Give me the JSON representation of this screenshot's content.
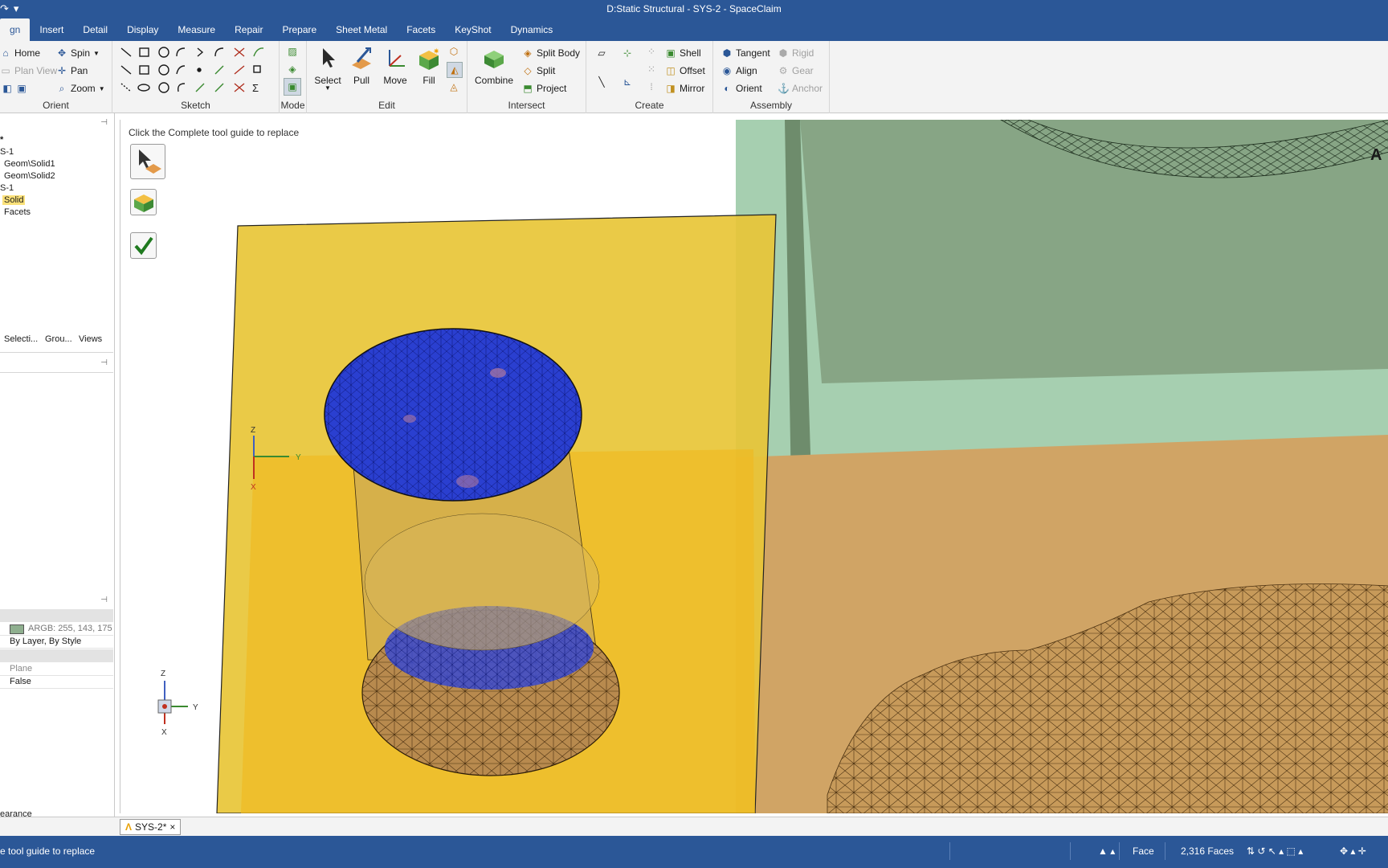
{
  "window": {
    "title": "D:Static Structural - SYS-2 - SpaceClaim"
  },
  "quick_access": {
    "redo": "↷",
    "more": "▾"
  },
  "tabs": [
    "gn",
    "Insert",
    "Detail",
    "Display",
    "Measure",
    "Repair",
    "Prepare",
    "Sheet Metal",
    "Facets",
    "KeyShot",
    "Dynamics"
  ],
  "ribbon": {
    "orient": {
      "label": "Orient",
      "home": "Home",
      "plan_view": "Plan View",
      "spin": "Spin",
      "pan": "Pan",
      "zoom": "Zoom"
    },
    "sketch": {
      "label": "Sketch"
    },
    "mode": {
      "label": "Mode"
    },
    "edit": {
      "label": "Edit",
      "select": "Select",
      "pull": "Pull",
      "move": "Move",
      "fill": "Fill"
    },
    "intersect": {
      "label": "Intersect",
      "combine": "Combine",
      "split_body": "Split Body",
      "split": "Split",
      "project": "Project"
    },
    "create": {
      "label": "Create",
      "shell": "Shell",
      "offset": "Offset",
      "mirror": "Mirror"
    },
    "assembly": {
      "label": "Assembly",
      "tangent": "Tangent",
      "align": "Align",
      "orient": "Orient",
      "rigid": "Rigid",
      "gear": "Gear",
      "anchor": "Anchor"
    }
  },
  "tree": {
    "items": [
      "*",
      "S-1",
      "Geom\\Solid1",
      "Geom\\Solid2",
      "S-1",
      "Solid",
      "Facets"
    ]
  },
  "panel_tabs": [
    "Selecti...",
    "Grou...",
    "Views"
  ],
  "properties": {
    "color_value": "ARGB: 255, 143, 175",
    "style": "By Layer, By Style",
    "plane": "Plane",
    "bool": "False",
    "appearance": "earance"
  },
  "viewport": {
    "hint": "Click the Complete tool guide to replace",
    "partial_label": "A"
  },
  "document_tab": {
    "label": "SYS-2*",
    "close": "×"
  },
  "status": {
    "message": "e tool guide to replace",
    "selection_filter": "Face",
    "count": "2,316 Faces"
  },
  "colors": {
    "title_blue": "#2b5797",
    "plane_yellow": "#e8c537",
    "cyl_blue": "#2a3fd0",
    "mesh_tan": "#c79a5a",
    "green_body": "#8aa888"
  }
}
